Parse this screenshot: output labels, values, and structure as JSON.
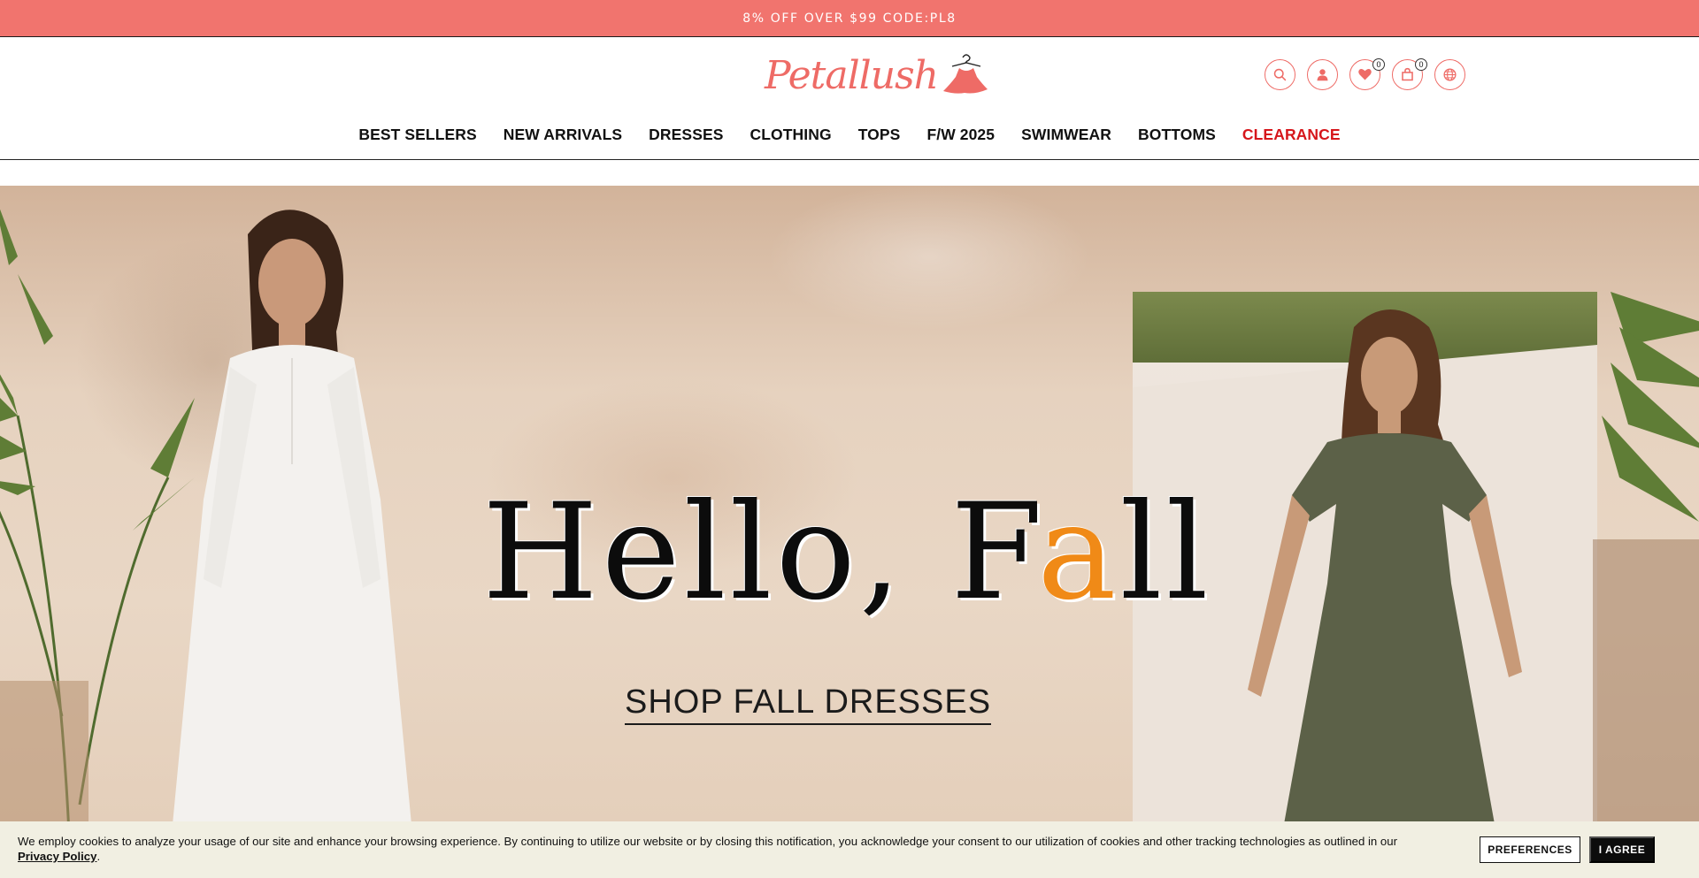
{
  "promo": {
    "text": "8% OFF OVER $99 CODE:PL8"
  },
  "brand": {
    "name": "Petallush",
    "color": "#ee6b66"
  },
  "header_icons": {
    "search": {
      "icon": "search-icon"
    },
    "account": {
      "icon": "user-icon"
    },
    "wishlist": {
      "icon": "heart-icon",
      "count": "0"
    },
    "cart": {
      "icon": "shopping-bag-icon",
      "count": "0"
    },
    "language": {
      "icon": "globe-icon"
    }
  },
  "nav": {
    "items": [
      {
        "label": "BEST SELLERS"
      },
      {
        "label": "NEW ARRIVALS"
      },
      {
        "label": "DRESSES"
      },
      {
        "label": "CLOTHING"
      },
      {
        "label": "TOPS"
      },
      {
        "label": "F/W 2025"
      },
      {
        "label": "SWIMWEAR"
      },
      {
        "label": "BOTTOMS"
      },
      {
        "label": "CLEARANCE",
        "color": "#d6161b"
      }
    ]
  },
  "hero": {
    "headline_before": "Hello, F",
    "headline_accent": "a",
    "headline_after": "ll",
    "accent_color": "#f08a17",
    "cta": "SHOP FALL DRESSES"
  },
  "cookie": {
    "message": "We employ cookies to analyze your usage of our site and enhance your browsing experience. By continuing to utilize our website or by closing this notification, you acknowledge your consent to our utilization of cookies and other tracking technologies as outlined in our",
    "link_label": "Privacy Policy",
    "suffix": ".",
    "preferences_label": "PREFERENCES",
    "agree_label": "I AGREE"
  }
}
